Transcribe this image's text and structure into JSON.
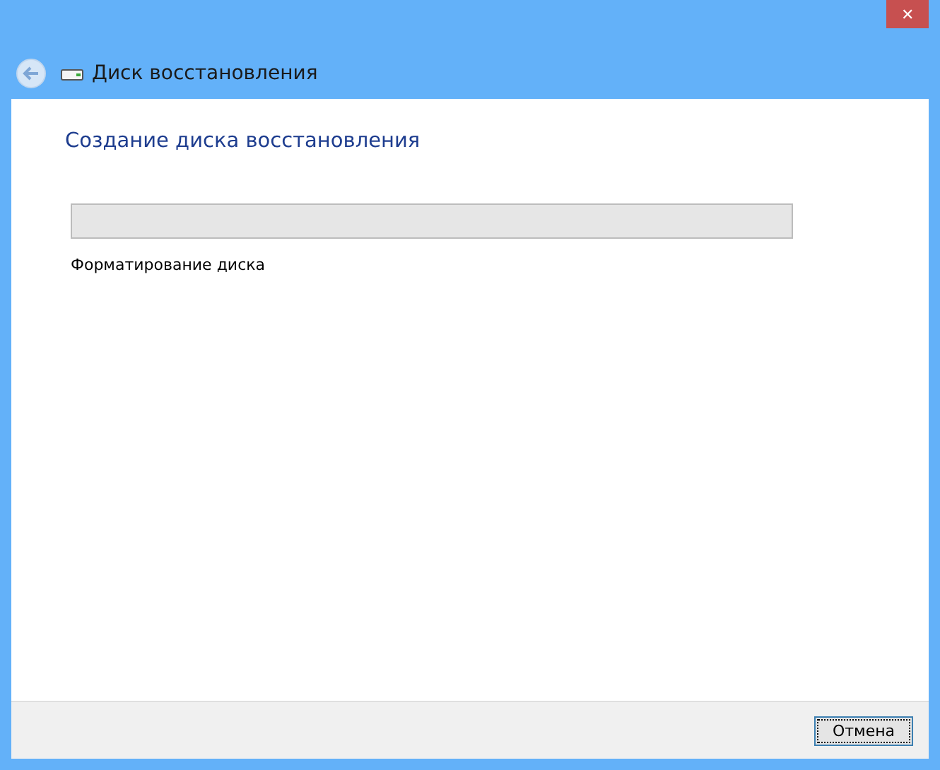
{
  "window": {
    "title": "Диск восстановления",
    "close": "✕"
  },
  "heading": "Создание диска восстановления",
  "progress": {
    "level": 0,
    "status": "Форматирование диска"
  },
  "buttons": [
    {
      "label": "Отмена",
      "focused": true
    }
  ]
}
